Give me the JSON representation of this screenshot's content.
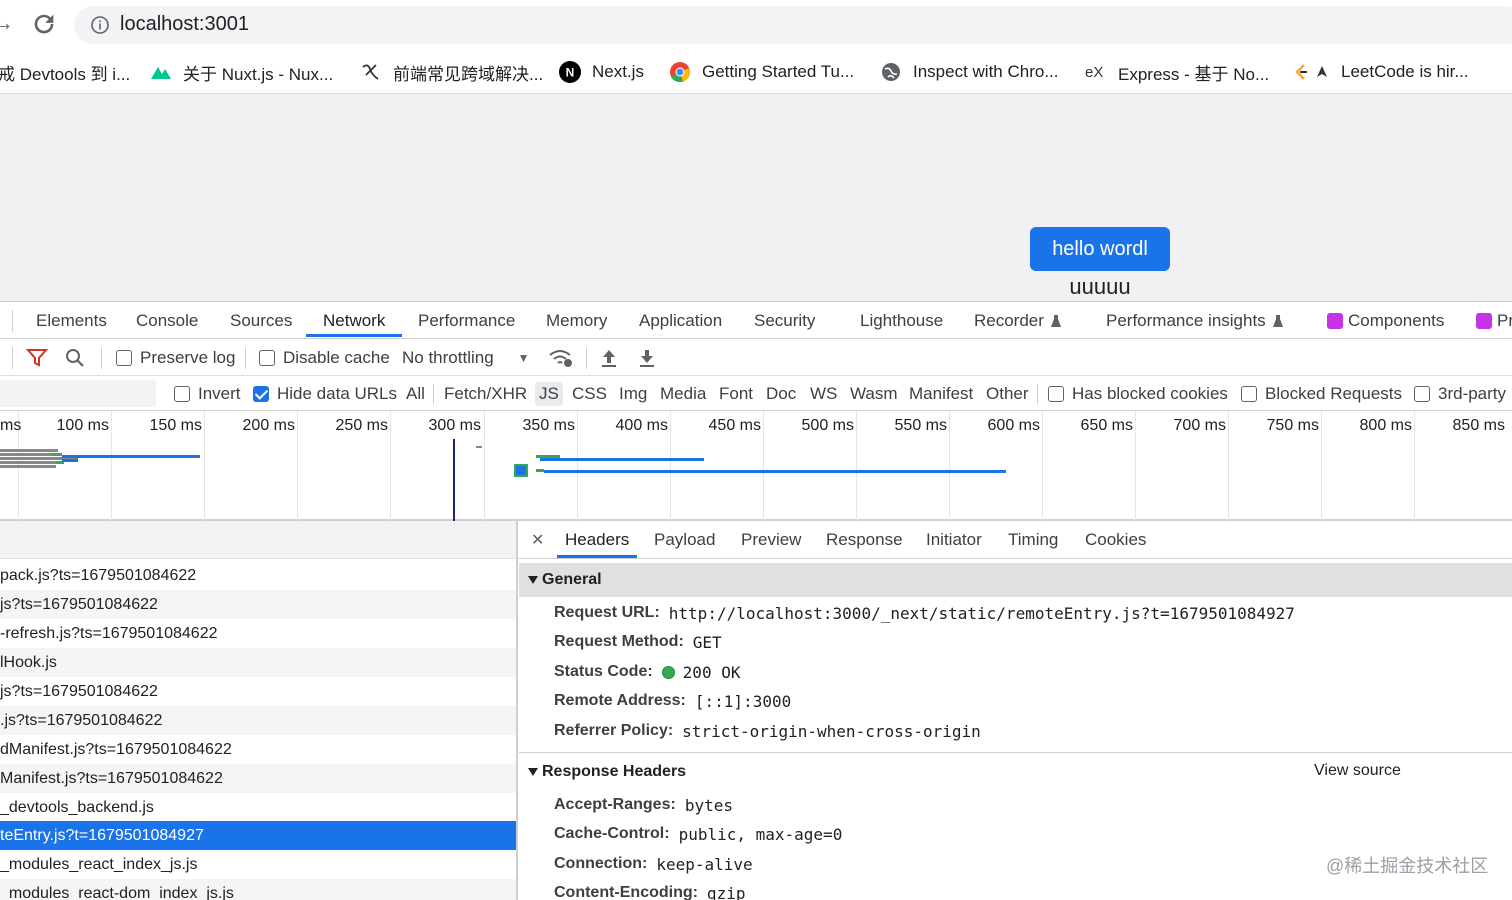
{
  "browser": {
    "url": "localhost:3001",
    "bookmarks": [
      {
        "label": "戒 Devtools 到 i...",
        "icon": "bookmark-icon"
      },
      {
        "label": "关于 Nuxt.js - Nux...",
        "icon": "nuxt-icon"
      },
      {
        "label": "前端常见跨域解决...",
        "icon": "squiggle-icon"
      },
      {
        "label": "Next.js",
        "icon": "nextjs-icon"
      },
      {
        "label": "Getting Started Tu...",
        "icon": "chrome-icon"
      },
      {
        "label": "Inspect with Chro...",
        "icon": "globe-icon"
      },
      {
        "label": "Express - 基于 No...",
        "icon": "express-icon"
      },
      {
        "label": "LeetCode is hir...",
        "icon": "leetcode-icon"
      }
    ]
  },
  "page": {
    "button_label": "hello wordl",
    "text": "uuuuu"
  },
  "devtools": {
    "tabs": [
      "Elements",
      "Console",
      "Sources",
      "Network",
      "Performance",
      "Memory",
      "Application",
      "Security",
      "Lighthouse",
      "Recorder",
      "Performance insights",
      "Components",
      "Pr"
    ],
    "active_tab": "Network",
    "toolbar": {
      "preserve_log": "Preserve log",
      "disable_cache": "Disable cache",
      "throttling": "No throttling"
    },
    "filters": {
      "invert": "Invert",
      "hide_data_urls": "Hide data URLs",
      "types": [
        "All",
        "Fetch/XHR",
        "JS",
        "CSS",
        "Img",
        "Media",
        "Font",
        "Doc",
        "WS",
        "Wasm",
        "Manifest",
        "Other"
      ],
      "active_type": "JS",
      "has_blocked_cookies": "Has blocked cookies",
      "blocked_requests": "Blocked Requests",
      "third_party": "3rd-party"
    },
    "timeline_labels": [
      "ms",
      "100 ms",
      "150 ms",
      "200 ms",
      "250 ms",
      "300 ms",
      "350 ms",
      "400 ms",
      "450 ms",
      "500 ms",
      "550 ms",
      "600 ms",
      "650 ms",
      "700 ms",
      "750 ms",
      "800 ms",
      "850 ms"
    ],
    "requests": [
      "pack.js?ts=1679501084622",
      "js?ts=1679501084622",
      "-refresh.js?ts=1679501084622",
      "lHook.js",
      "js?ts=1679501084622",
      ".js?ts=1679501084622",
      "dManifest.js?ts=1679501084622",
      "Manifest.js?ts=1679501084622",
      "_devtools_backend.js",
      "teEntry.js?t=1679501084927",
      "_modules_react_index_js.js",
      "_modules_react-dom_index_js.js"
    ],
    "selected_request_index": 9,
    "detail_tabs": [
      "Headers",
      "Payload",
      "Preview",
      "Response",
      "Initiator",
      "Timing",
      "Cookies"
    ],
    "general": {
      "title": "General",
      "request_url_label": "Request URL:",
      "request_url": "http://localhost:3000/_next/static/remoteEntry.js?t=1679501084927",
      "request_method_label": "Request Method:",
      "request_method": "GET",
      "status_code_label": "Status Code:",
      "status_code": "200 OK",
      "remote_address_label": "Remote Address:",
      "remote_address": "[::1]:3000",
      "referrer_policy_label": "Referrer Policy:",
      "referrer_policy": "strict-origin-when-cross-origin"
    },
    "response_headers": {
      "title": "Response Headers",
      "view_source": "View source",
      "items": [
        {
          "key": "Accept-Ranges:",
          "value": "bytes"
        },
        {
          "key": "Cache-Control:",
          "value": "public, max-age=0"
        },
        {
          "key": "Connection:",
          "value": "keep-alive"
        },
        {
          "key": "Content-Encoding:",
          "value": "gzip"
        }
      ]
    }
  },
  "watermark": "@稀土掘金技术社区"
}
